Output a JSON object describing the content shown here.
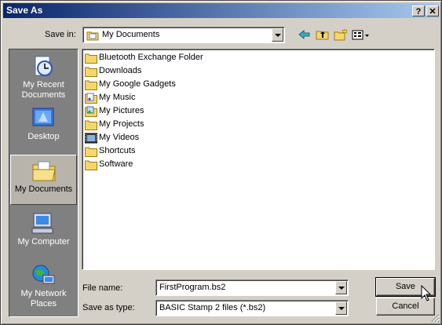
{
  "window": {
    "title": "Save As",
    "help_label": "?",
    "close_label": "✕"
  },
  "toolbar": {
    "save_in_label": "Save in:",
    "location": "My Documents",
    "icons": [
      "back-arrow-icon",
      "up-folder-icon",
      "new-folder-icon",
      "view-menu-icon"
    ]
  },
  "places": [
    {
      "label": "My Recent Documents",
      "icon": "recent-documents-icon",
      "selected": false
    },
    {
      "label": "Desktop",
      "icon": "desktop-icon",
      "selected": false
    },
    {
      "label": "My Documents",
      "icon": "my-documents-icon",
      "selected": true
    },
    {
      "label": "My Computer",
      "icon": "my-computer-icon",
      "selected": false
    },
    {
      "label": "My Network Places",
      "icon": "network-places-icon",
      "selected": false
    }
  ],
  "files": [
    {
      "label": "Bluetooth Exchange Folder",
      "icon": "folder-icon"
    },
    {
      "label": "Downloads",
      "icon": "folder-icon"
    },
    {
      "label": "My Google Gadgets",
      "icon": "folder-icon"
    },
    {
      "label": "My Music",
      "icon": "music-folder-icon"
    },
    {
      "label": "My Pictures",
      "icon": "pictures-folder-icon"
    },
    {
      "label": "My Projects",
      "icon": "folder-icon"
    },
    {
      "label": "My Videos",
      "icon": "videos-folder-icon"
    },
    {
      "label": "Shortcuts",
      "icon": "folder-icon"
    },
    {
      "label": "Software",
      "icon": "folder-icon"
    }
  ],
  "form": {
    "file_name_label": "File name:",
    "file_name_value": "FirstProgram.bs2",
    "save_type_label": "Save as type:",
    "save_type_value": "BASIC Stamp 2 files (*.bs2)",
    "save_button": "Save",
    "cancel_button": "Cancel"
  },
  "colors": {
    "titlebar_start": "#0a246a",
    "titlebar_end": "#a6caf0",
    "face": "#d4d0c8",
    "places_bar": "#808080"
  }
}
